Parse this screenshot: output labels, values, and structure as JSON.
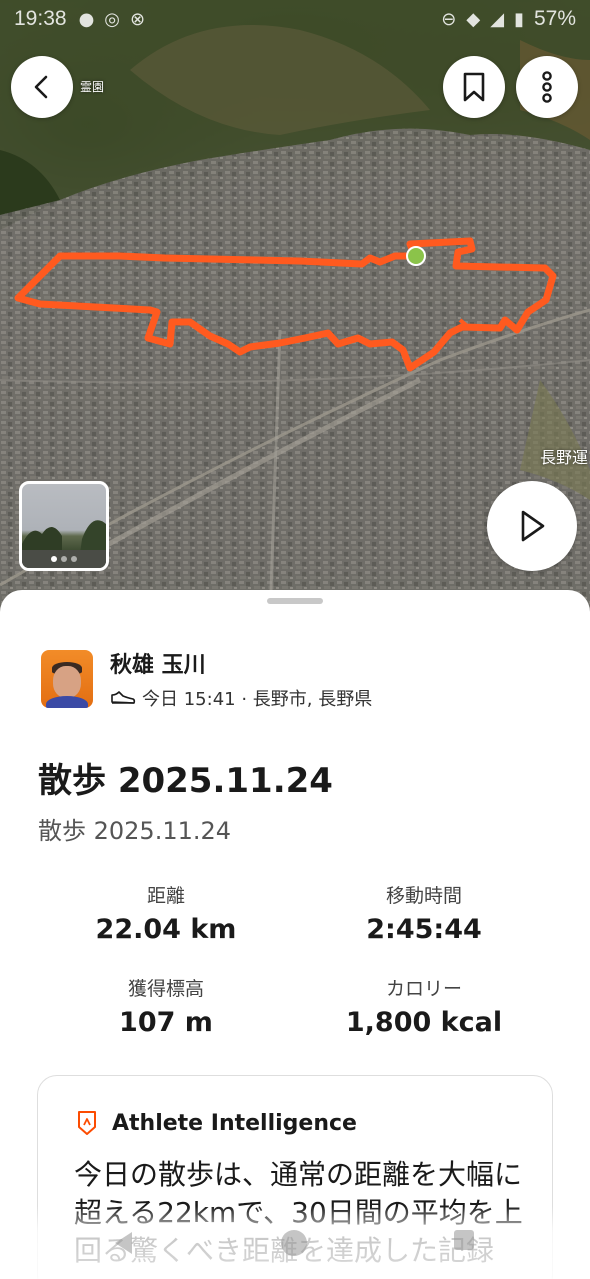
{
  "status_bar": {
    "time": "19:38",
    "battery": "57%"
  },
  "map": {
    "labels": {
      "temple": "霊園",
      "park": "長野運"
    },
    "route_color": "#ff5a1f",
    "start_marker_color": "#8bc34a"
  },
  "header": {
    "back_icon": "chevron-left-icon",
    "bookmark_icon": "bookmark-icon",
    "more_icon": "more-vertical-icon"
  },
  "athlete": {
    "name": "秋雄 玉川",
    "meta": "今日 15:41 · 長野市, 長野県",
    "activity_icon": "shoe-icon"
  },
  "activity": {
    "title": "散歩 2025.11.24",
    "subtitle": "散歩 2025.11.24"
  },
  "stats": {
    "distance": {
      "label": "距離",
      "value": "22.04 km"
    },
    "moving_time": {
      "label": "移動時間",
      "value": "2:45:44"
    },
    "elevation": {
      "label": "獲得標高",
      "value": "107 m"
    },
    "calories": {
      "label": "カロリー",
      "value": "1,800 kcal"
    }
  },
  "athlete_intelligence": {
    "title": "Athlete Intelligence",
    "text": "今日の散歩は、通常の距離を大幅に超える22kmで、30日間の平均を上回る驚くべき距離を達成した記録"
  },
  "colors": {
    "accent": "#fc4c02",
    "text": "#1a1a1a"
  }
}
